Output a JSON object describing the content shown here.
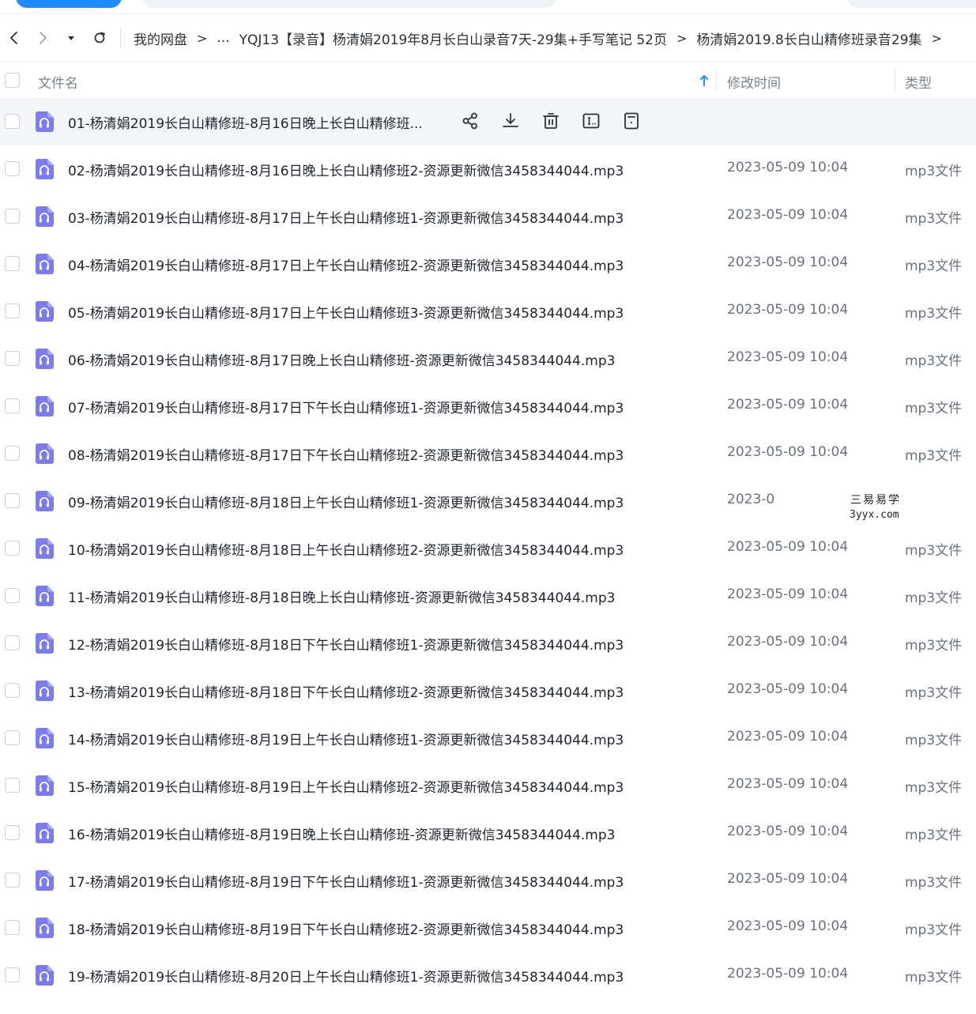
{
  "nav": {
    "breadcrumbs": [
      "我的网盘",
      "...",
      "YQJ13【录音】杨清娟2019年8月长白山录音7天-29集+手写笔记 52页",
      "杨清娟2019.8长白山精修班录音29集"
    ],
    "arrow": ">"
  },
  "columns": {
    "name": "文件名",
    "modified": "修改时间",
    "type": "类型"
  },
  "files": [
    {
      "name": "01-杨清娟2019长白山精修班-8月16日晚上长白山精修班...",
      "date": "",
      "type": ""
    },
    {
      "name": "02-杨清娟2019长白山精修班-8月16日晚上长白山精修班2-资源更新微信3458344044.mp3",
      "date": "2023-05-09 10:04",
      "type": "mp3文件"
    },
    {
      "name": "03-杨清娟2019长白山精修班-8月17日上午长白山精修班1-资源更新微信3458344044.mp3",
      "date": "2023-05-09 10:04",
      "type": "mp3文件"
    },
    {
      "name": "04-杨清娟2019长白山精修班-8月17日上午长白山精修班2-资源更新微信3458344044.mp3",
      "date": "2023-05-09 10:04",
      "type": "mp3文件"
    },
    {
      "name": "05-杨清娟2019长白山精修班-8月17日上午长白山精修班3-资源更新微信3458344044.mp3",
      "date": "2023-05-09 10:04",
      "type": "mp3文件"
    },
    {
      "name": "06-杨清娟2019长白山精修班-8月17日晚上长白山精修班-资源更新微信3458344044.mp3",
      "date": "2023-05-09 10:04",
      "type": "mp3文件"
    },
    {
      "name": "07-杨清娟2019长白山精修班-8月17日下午长白山精修班1-资源更新微信3458344044.mp3",
      "date": "2023-05-09 10:04",
      "type": "mp3文件"
    },
    {
      "name": "08-杨清娟2019长白山精修班-8月17日下午长白山精修班2-资源更新微信3458344044.mp3",
      "date": "2023-05-09 10:04",
      "type": "mp3文件"
    },
    {
      "name": "09-杨清娟2019长白山精修班-8月18日上午长白山精修班1-资源更新微信3458344044.mp3",
      "date": "2023-0",
      "type": ""
    },
    {
      "name": "10-杨清娟2019长白山精修班-8月18日上午长白山精修班2-资源更新微信3458344044.mp3",
      "date": "2023-05-09 10:04",
      "type": "mp3文件"
    },
    {
      "name": "11-杨清娟2019长白山精修班-8月18日晚上长白山精修班-资源更新微信3458344044.mp3",
      "date": "2023-05-09 10:04",
      "type": "mp3文件"
    },
    {
      "name": "12-杨清娟2019长白山精修班-8月18日下午长白山精修班1-资源更新微信3458344044.mp3",
      "date": "2023-05-09 10:04",
      "type": "mp3文件"
    },
    {
      "name": "13-杨清娟2019长白山精修班-8月18日下午长白山精修班2-资源更新微信3458344044.mp3",
      "date": "2023-05-09 10:04",
      "type": "mp3文件"
    },
    {
      "name": "14-杨清娟2019长白山精修班-8月19日上午长白山精修班1-资源更新微信3458344044.mp3",
      "date": "2023-05-09 10:04",
      "type": "mp3文件"
    },
    {
      "name": "15-杨清娟2019长白山精修班-8月19日上午长白山精修班2-资源更新微信3458344044.mp3",
      "date": "2023-05-09 10:04",
      "type": "mp3文件"
    },
    {
      "name": "16-杨清娟2019长白山精修班-8月19日晚上长白山精修班-资源更新微信3458344044.mp3",
      "date": "2023-05-09 10:04",
      "type": "mp3文件"
    },
    {
      "name": "17-杨清娟2019长白山精修班-8月19日下午长白山精修班1-资源更新微信3458344044.mp3",
      "date": "2023-05-09 10:04",
      "type": "mp3文件"
    },
    {
      "name": "18-杨清娟2019长白山精修班-8月19日下午长白山精修班2-资源更新微信3458344044.mp3",
      "date": "2023-05-09 10:04",
      "type": "mp3文件"
    },
    {
      "name": "19-杨清娟2019长白山精修班-8月20日上午长白山精修班1-资源更新微信3458344044.mp3",
      "date": "2023-05-09 10:04",
      "type": "mp3文件"
    }
  ],
  "watermark": {
    "line1": "三易易学",
    "line2": "3yyx.com"
  },
  "colors": {
    "accent": "#1f8bff",
    "audio_icon": "#7b7cf2",
    "hover_row": "#f3f5f8"
  },
  "icons": {
    "file": "audio-file-icon",
    "row_actions": [
      "share-icon",
      "download-icon",
      "delete-icon",
      "rename-icon",
      "more-icon"
    ]
  }
}
